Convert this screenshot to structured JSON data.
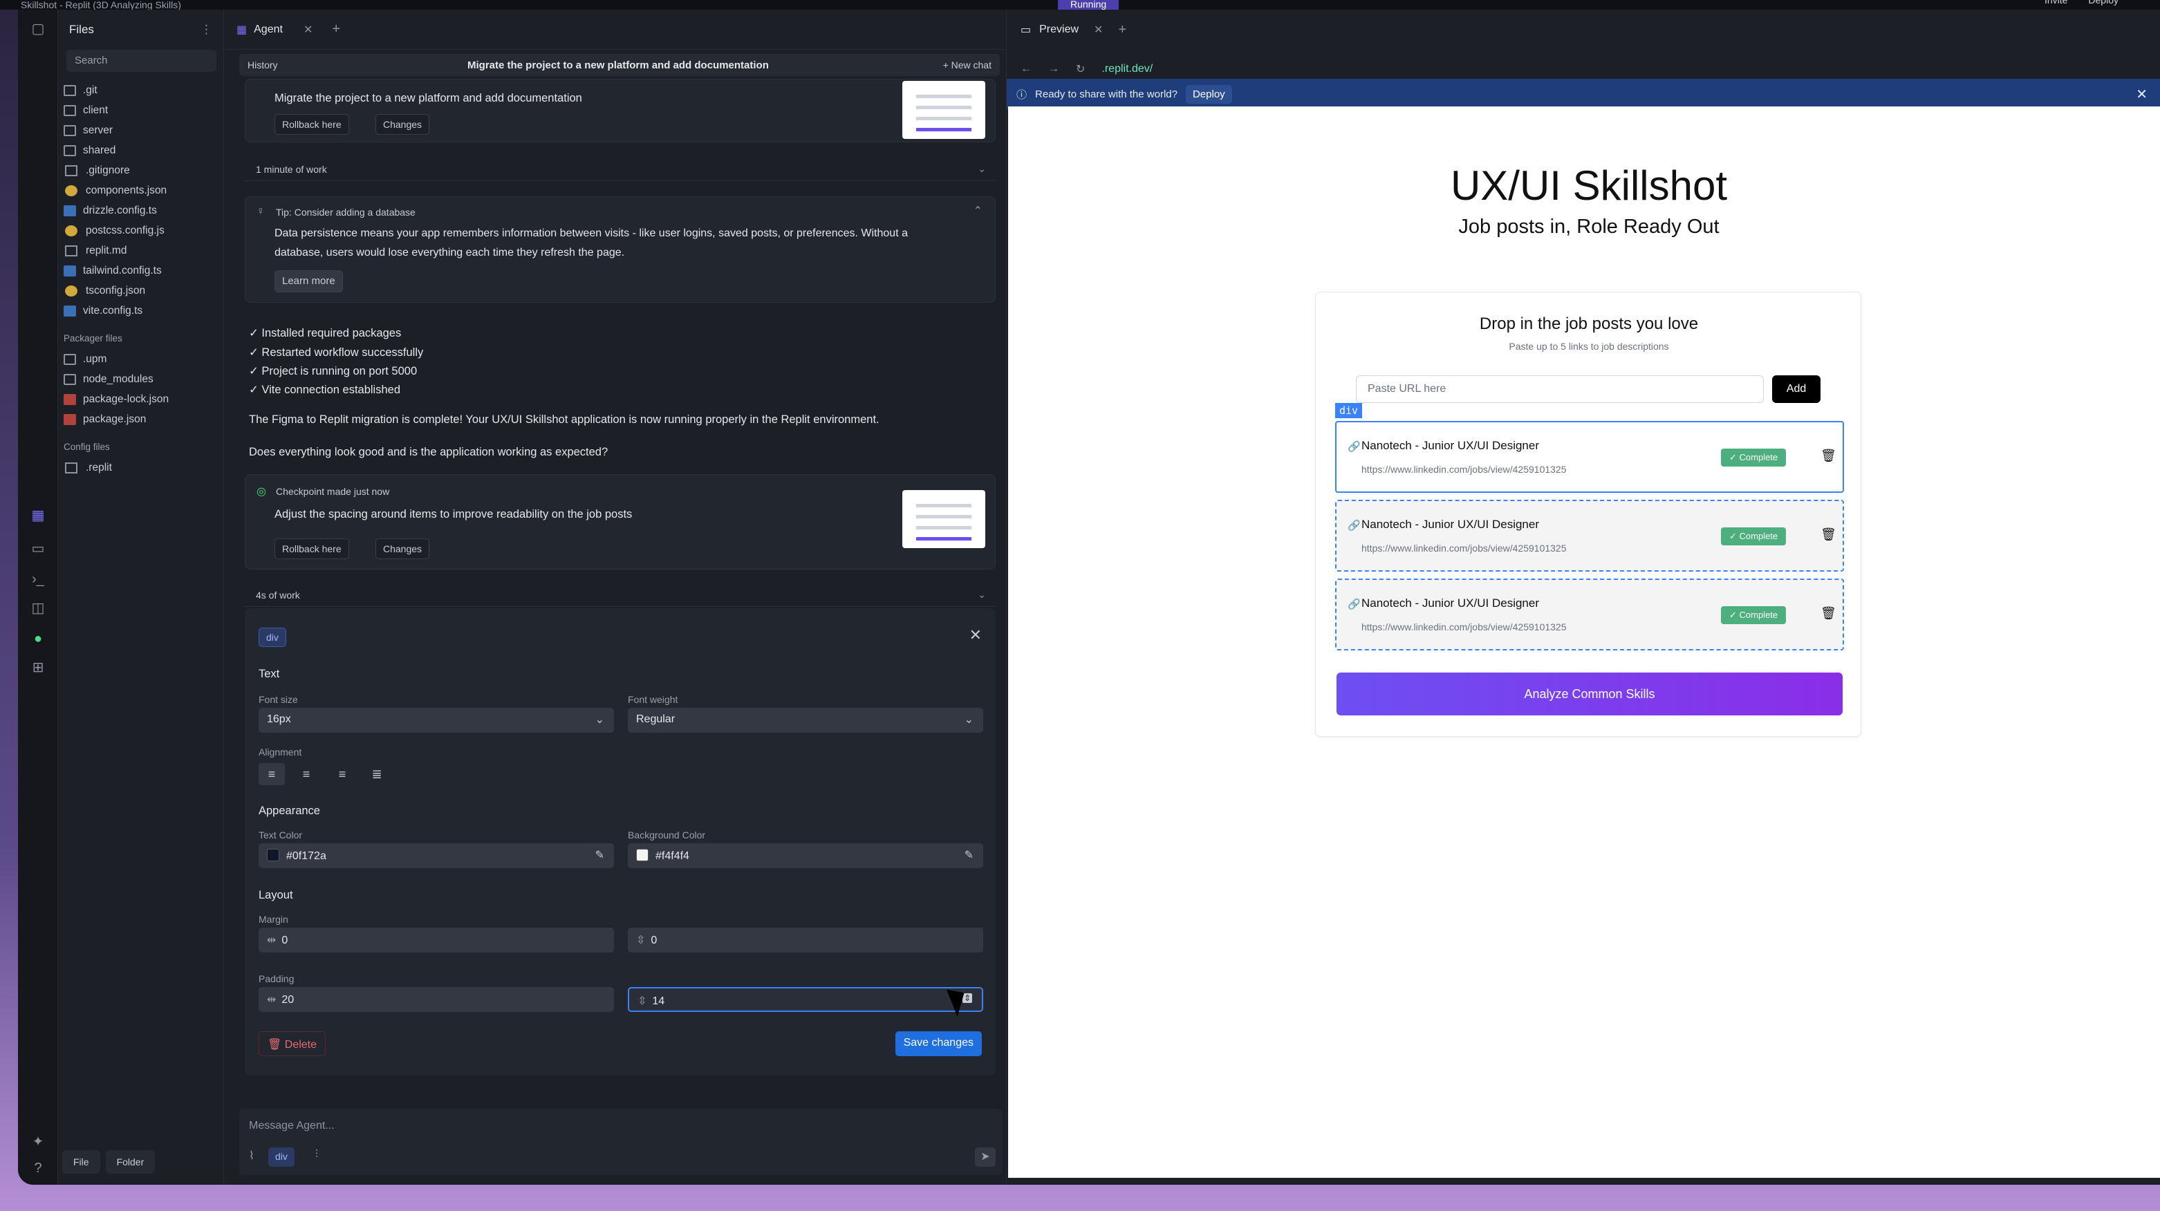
{
  "topbar": {
    "title": "Skillshot - Replit (3D Analyzing Skills)",
    "running": "Running",
    "invite": "Invite",
    "deploy": "Deploy"
  },
  "files": {
    "title": "Files",
    "search_placeholder": "Search",
    "items": [
      ".git",
      "client",
      "server",
      "shared",
      ".gitignore",
      "components.json",
      "drizzle.config.ts",
      "postcss.config.js",
      "replit.md",
      "tailwind.config.ts",
      "tsconfig.json",
      "vite.config.ts"
    ],
    "packager_title": "Packager files",
    "packager_items": [
      ".upm",
      "node_modules",
      "package-lock.json",
      "package.json"
    ],
    "config_title": "Config files",
    "config_items": [
      ".replit"
    ],
    "bottom_file": "File",
    "bottom_folder": "Folder"
  },
  "agent": {
    "tab_label": "Agent",
    "history_label": "History",
    "history_title": "Migrate the project to a new platform and add documentation",
    "new_chat": "+ New chat",
    "checkpoint1_msg": "Migrate the project to a new platform and add documentation",
    "rollback_label": "Rollback here",
    "changes_label": "Changes",
    "work1": "1 minute of work",
    "tip_title": "Tip: Consider adding a database",
    "tip_body1": "Data persistence means your app remembers information between visits - like user logins, saved posts, or preferences. Without a",
    "tip_body2": "database, users would lose everything each time they refresh the page.",
    "learn_more": "Learn more",
    "checks": [
      "✓ Installed required packages",
      "✓ Restarted workflow successfully",
      "✓ Project is running on port 5000",
      "✓ Vite connection established"
    ],
    "summary": "The Figma to Replit migration is complete! Your UX/UI Skillshot application is now running properly in the Replit environment.",
    "question": "Does everything look good and is the application working as expected?",
    "checkpoint2_title": "Checkpoint made just now",
    "checkpoint2_msg": "Adjust the spacing around items to improve readability on the job posts",
    "work2": "4s of work",
    "message_placeholder": "Message Agent..."
  },
  "editor": {
    "chip": "div",
    "text_heading": "Text",
    "font_size_label": "Font size",
    "font_size": "16px",
    "font_weight_label": "Font weight",
    "font_weight": "Regular",
    "alignment_label": "Alignment",
    "appearance_heading": "Appearance",
    "text_color_label": "Text Color",
    "text_color": "#0f172a",
    "bg_color_label": "Background Color",
    "bg_color": "#f4f4f4",
    "layout_heading": "Layout",
    "margin_label": "Margin",
    "margin_x": "0",
    "margin_y": "0",
    "padding_label": "Padding",
    "padding_x": "20",
    "padding_y": "14",
    "delete_label": "Delete",
    "save_label": "Save changes"
  },
  "preview": {
    "tab_label": "Preview",
    "url": ".replit.dev/",
    "banner_text": "Ready to share with the world?",
    "banner_deploy": "Deploy",
    "app_title": "UX/UI Skillshot",
    "app_subtitle": "Job posts in, Role Ready Out",
    "card_title": "Drop in the job posts you love",
    "card_sub": "Paste up to 5 links to job descriptions",
    "url_placeholder": "Paste URL here",
    "add_label": "Add",
    "selected_tag": "div",
    "jobs": [
      {
        "title": "Nanotech - Junior UX/UI Designer",
        "url": "https://www.linkedin.com/jobs/view/4259101325",
        "status": "✓ Complete"
      },
      {
        "title": "Nanotech - Junior UX/UI Designer",
        "url": "https://www.linkedin.com/jobs/view/4259101325",
        "status": "✓ Complete"
      },
      {
        "title": "Nanotech - Junior UX/UI Designer",
        "url": "https://www.linkedin.com/jobs/view/4259101325",
        "status": "✓ Complete"
      }
    ],
    "analyze_label": "Analyze Common Skills"
  }
}
